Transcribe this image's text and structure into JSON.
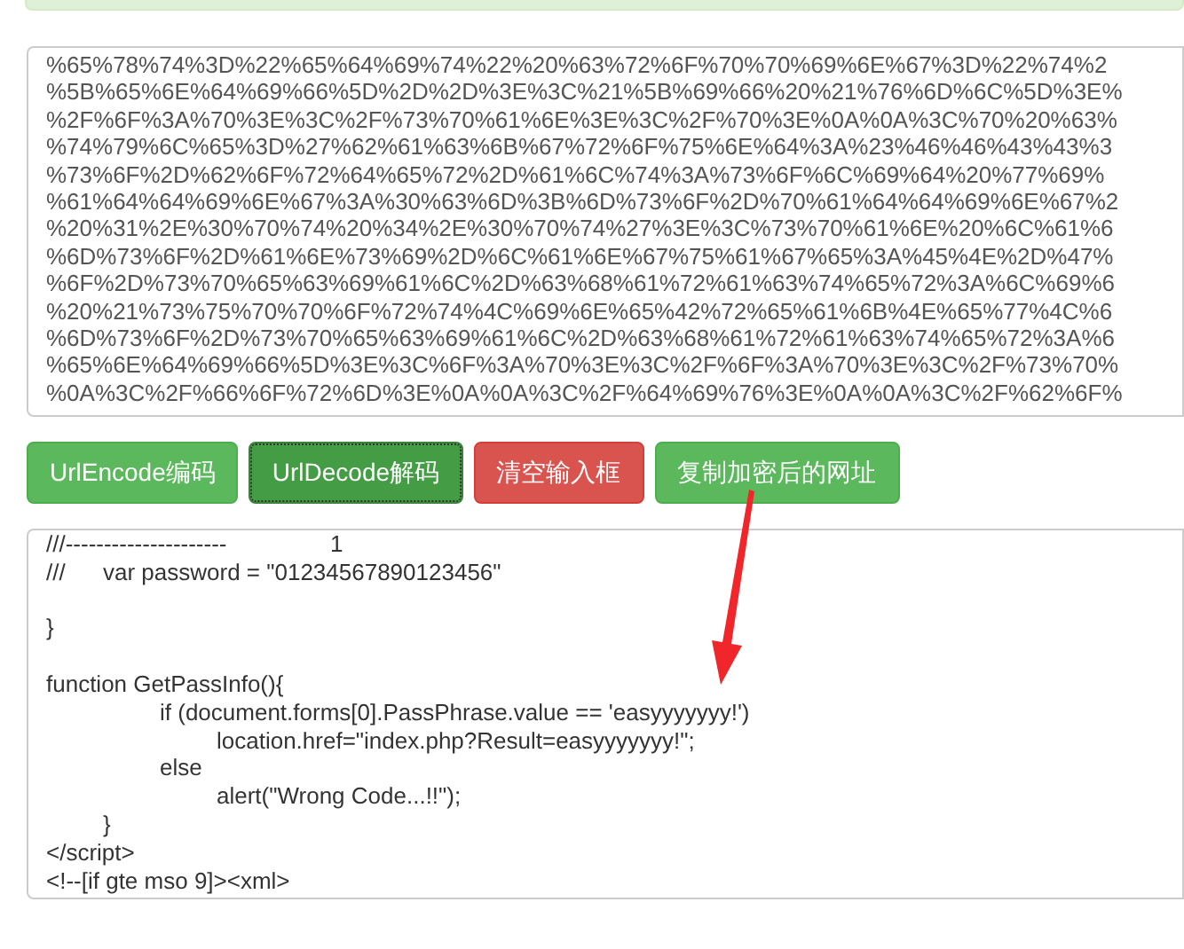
{
  "encoded_text": [
    "%65%78%74%3D%22%65%64%69%74%22%20%63%72%6F%70%70%69%6E%67%3D%22%74%2",
    "%5B%65%6E%64%69%66%5D%2D%2D%3E%3C%21%5B%69%66%20%21%76%6D%6C%5D%3E%",
    "%2F%6F%3A%70%3E%3C%2F%73%70%61%6E%3E%3C%2F%70%3E%0A%0A%3C%70%20%63%",
    "%74%79%6C%65%3D%27%62%61%63%6B%67%72%6F%75%6E%64%3A%23%46%46%43%43%3",
    "%73%6F%2D%62%6F%72%64%65%72%2D%61%6C%74%3A%73%6F%6C%69%64%20%77%69%",
    "%61%64%64%69%6E%67%3A%30%63%6D%3B%6D%73%6F%2D%70%61%64%64%69%6E%67%2",
    "%20%31%2E%30%70%74%20%34%2E%30%70%74%27%3E%3C%73%70%61%6E%20%6C%61%6",
    "%6D%73%6F%2D%61%6E%73%69%2D%6C%61%6E%67%75%61%67%65%3A%45%4E%2D%47%",
    "%6F%2D%73%70%65%63%69%61%6C%2D%63%68%61%72%61%63%74%65%72%3A%6C%69%6",
    "%20%21%73%75%70%70%6F%72%74%4C%69%6E%65%42%72%65%61%6B%4E%65%77%4C%6",
    "%6D%73%6F%2D%73%70%65%63%69%61%6C%2D%63%68%61%72%61%63%74%65%72%3A%6",
    "%65%6E%64%69%66%5D%3E%3C%6F%3A%70%3E%3C%2F%6F%3A%70%3E%3C%2F%73%70%",
    "%0A%3C%2F%66%6F%72%6D%3E%0A%0A%3C%2F%64%69%76%3E%0A%0A%3C%2F%62%6F%"
  ],
  "buttons": [
    {
      "label": "UrlEncode编码",
      "kind": "success",
      "selected": false
    },
    {
      "label": "UrlDecode解码",
      "kind": "success",
      "selected": true
    },
    {
      "label": "清空输入框",
      "kind": "danger",
      "selected": false
    },
    {
      "label": "复制加密后的网址",
      "kind": "success",
      "selected": false
    }
  ],
  "decoded_text": [
    {
      "kind": "code",
      "text": "///---------------------\t\t1"
    },
    {
      "kind": "code",
      "text": "///\tvar password = \"01234567890123456\""
    },
    {
      "kind": "blank"
    },
    {
      "kind": "code",
      "text": "}"
    },
    {
      "kind": "blank"
    },
    {
      "kind": "code",
      "text": "function GetPassInfo(){"
    },
    {
      "kind": "code",
      "text": "\t\tif (document.forms[0].PassPhrase.value == 'easyyyyyyy!')"
    },
    {
      "kind": "code",
      "text": "\t\t\tlocation.href=\"index.php?Result=easyyyyyyy!\";"
    },
    {
      "kind": "code",
      "text": "\t\telse"
    },
    {
      "kind": "code",
      "text": "\t\t\talert(\"Wrong Code...!!\");"
    },
    {
      "kind": "code",
      "text": "\t}"
    },
    {
      "kind": "code",
      "text": "</script>"
    },
    {
      "kind": "code",
      "text": "<!--[if gte mso 9]><xml>"
    }
  ]
}
